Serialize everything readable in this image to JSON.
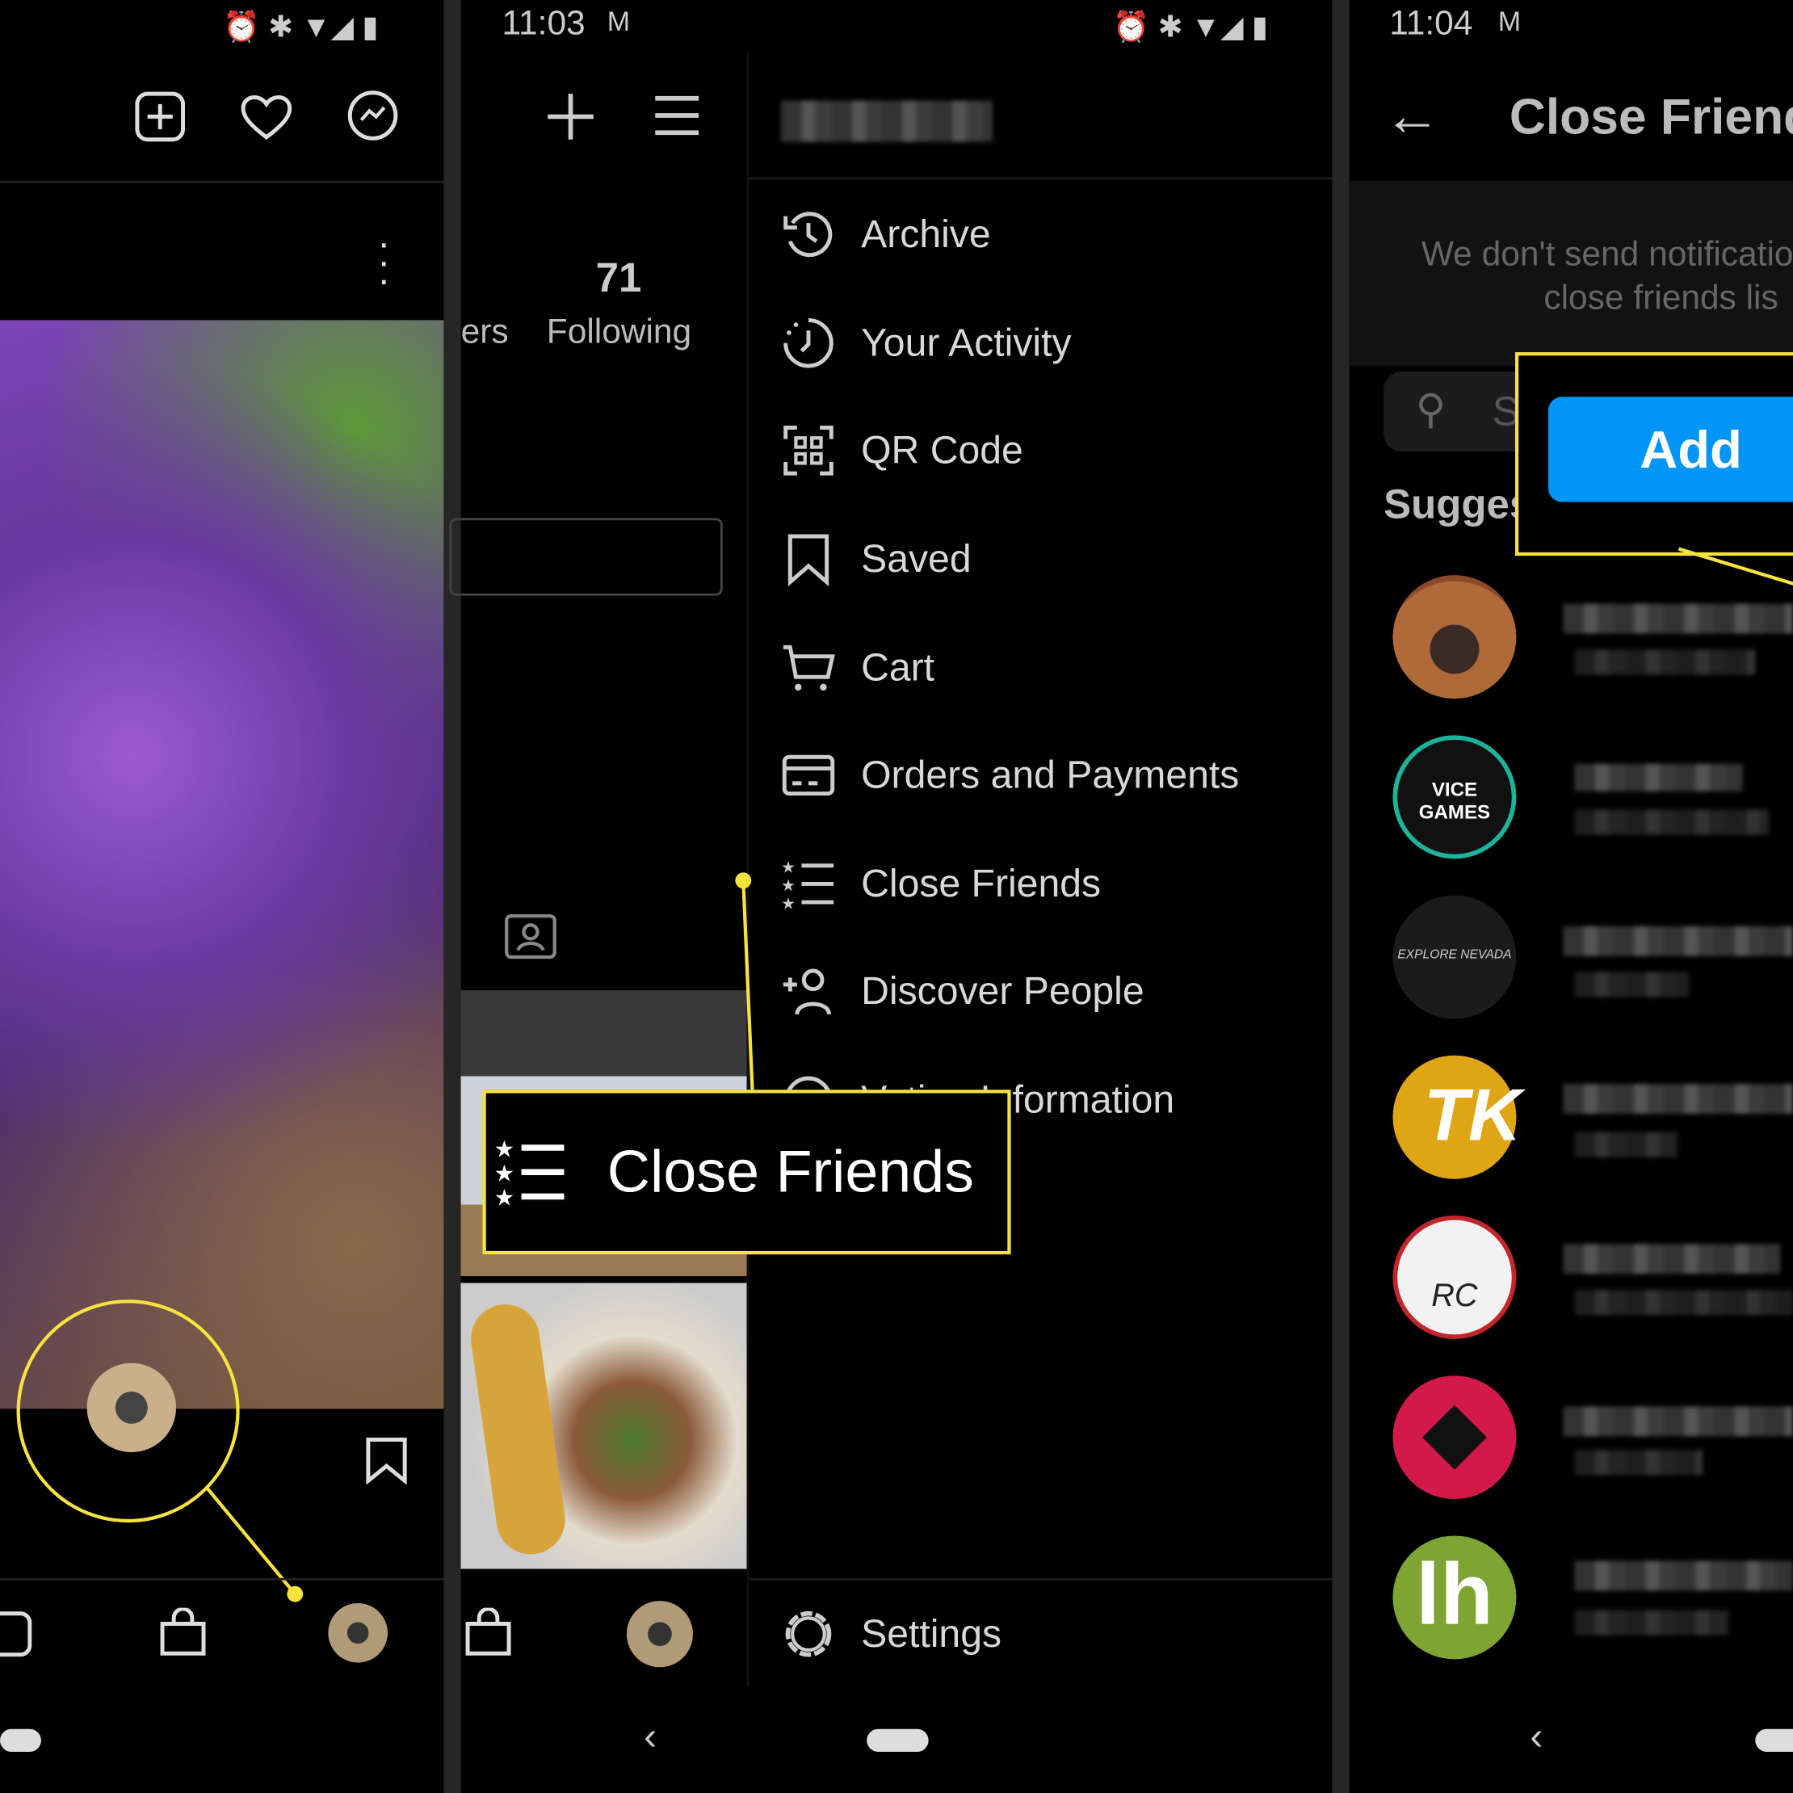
{
  "panel1": {
    "status_icons": [
      "alarm-icon",
      "bluetooth-icon",
      "wifi-icon",
      "signal-icon",
      "battery-icon"
    ],
    "header_icons": [
      "new-post-icon",
      "heart-icon",
      "messenger-icon"
    ]
  },
  "panel2": {
    "status_time": "11:03",
    "following_count": "71",
    "following_label": "Following",
    "followers_label_partial": "ers",
    "menu": [
      {
        "label": "Archive",
        "icon": "archive-icon"
      },
      {
        "label": "Your Activity",
        "icon": "activity-icon"
      },
      {
        "label": "QR Code",
        "icon": "qr-code-icon"
      },
      {
        "label": "Saved",
        "icon": "bookmark-icon"
      },
      {
        "label": "Cart",
        "icon": "cart-icon"
      },
      {
        "label": "Orders and Payments",
        "icon": "card-icon"
      },
      {
        "label": "Close Friends",
        "icon": "close-friends-icon"
      },
      {
        "label": "Discover People",
        "icon": "add-person-icon"
      },
      {
        "label": "Voting Information",
        "icon": "info-icon"
      }
    ],
    "settings_label": "Settings",
    "callout_label": "Close Friends"
  },
  "panel3": {
    "status_time": "11:04",
    "title": "Close Friends",
    "notice_line1": "We don't send notificatio",
    "notice_line2": "close friends lis",
    "search_placeholder": "S",
    "suggested_label": "Sugges",
    "add_button": "Add",
    "vice_logo": "VICE GAMES",
    "nevada_logo": "EXPLORE NEVADA",
    "rc_logo": "RC",
    "lh_logo": "lh"
  },
  "colors": {
    "accent_blue": "#0095f6",
    "callout_yellow": "#f7e23e"
  }
}
